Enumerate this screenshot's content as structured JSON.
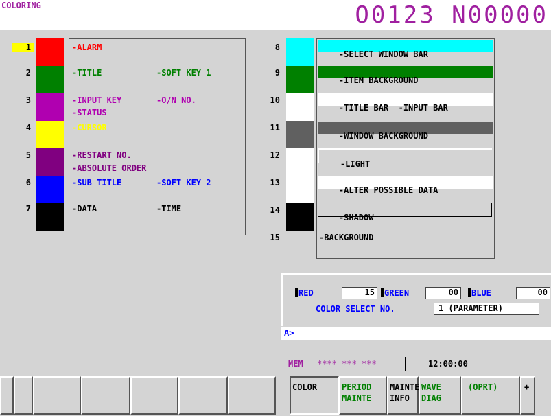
{
  "header": {
    "screen_title": "COLORING",
    "program_number": "O0123 N00000"
  },
  "left_rows": [
    {
      "num": "1",
      "color": "#ff0000"
    },
    {
      "num": "2",
      "color": "#008000"
    },
    {
      "num": "3",
      "color": "#b000b0"
    },
    {
      "num": "4",
      "color": "#ffff00"
    },
    {
      "num": "5",
      "color": "#800080"
    },
    {
      "num": "6",
      "color": "#0000ff"
    },
    {
      "num": "7",
      "color": "#000000"
    }
  ],
  "left_labels": {
    "alarm": "-ALARM",
    "title": "-TITLE",
    "soft_key_1": "-SOFT KEY 1",
    "input_key": "-INPUT KEY",
    "on_no": "-O/N NO.",
    "status": "-STATUS",
    "cursor": "-CURSOR",
    "restart_no": "-RESTART NO.",
    "absolute_order": "-ABSOLUTE ORDER",
    "sub_title": "-SUB TITLE",
    "soft_key_2": "-SOFT KEY 2",
    "data": "-DATA",
    "time": "-TIME"
  },
  "right_rows": [
    {
      "num": "8",
      "color": "#00ffff"
    },
    {
      "num": "9",
      "color": "#008000"
    },
    {
      "num": "10",
      "color": "#ffffff"
    },
    {
      "num": "11",
      "color": "#606060"
    },
    {
      "num": "12",
      "color": "#ffffff"
    },
    {
      "num": "13",
      "color": "#ffffff"
    },
    {
      "num": "14",
      "color": "#000000"
    },
    {
      "num": "15",
      "color": "#d4d4d4"
    }
  ],
  "right_labels": {
    "select_window_bar": "-SELECT WINDOW BAR",
    "item_background": "-ITEM BACKGROUND",
    "title_bar": "-TITLE BAR",
    "input_bar": "-INPUT BAR",
    "window_background": "-WINDOW BACKGROUND",
    "light": "-LIGHT",
    "alter_possible_data": "-ALTER POSSIBLE DATA",
    "shadow": "-SHADOW",
    "background": "-BACKGROUND"
  },
  "rgb": {
    "red_label": "RED",
    "red_value": "15",
    "green_label": "GREEN",
    "green_value": "00",
    "blue_label": "BLUE",
    "blue_value": "00"
  },
  "color_select": {
    "label": "COLOR SELECT NO.",
    "value": "1 (PARAMETER)"
  },
  "input_line": {
    "prompt": "A>"
  },
  "status_line": {
    "mode": "MEM",
    "status": "**** *** ***",
    "time": "12:00:00"
  },
  "softkeys": {
    "color": "COLOR",
    "period_mainte": "PERIOD\nMAINTE",
    "mainte_info": "MAINTE\nINFO",
    "wave_diag": "WAVE\nDIAG",
    "oprt": "(OPRT)",
    "next": "+"
  }
}
